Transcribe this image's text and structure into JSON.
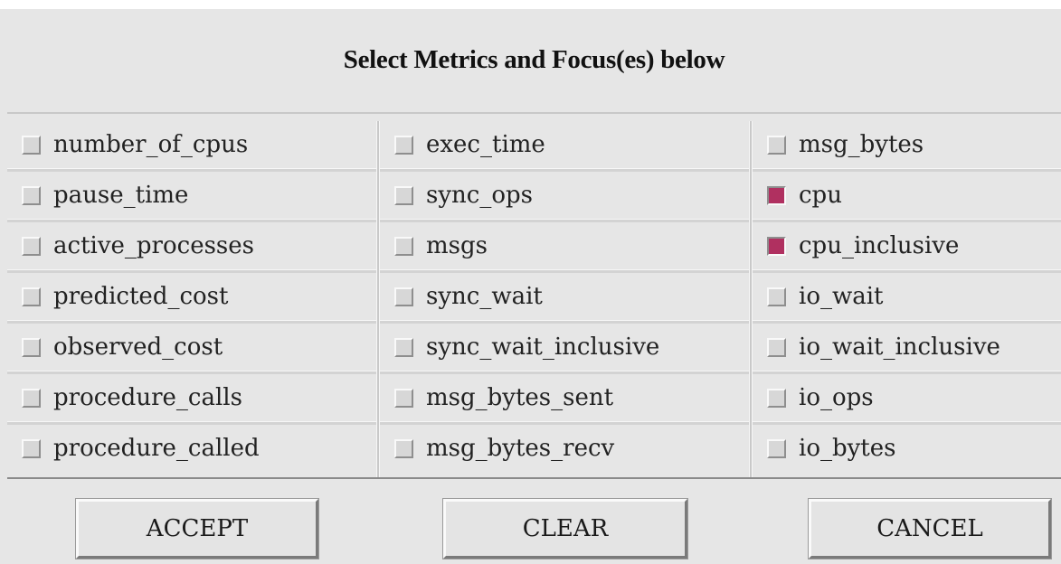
{
  "dialog": {
    "title": "Select Metrics and Focus(es) below"
  },
  "metrics": {
    "columns": [
      [
        {
          "label": "number_of_cpus",
          "checked": false
        },
        {
          "label": "pause_time",
          "checked": false
        },
        {
          "label": "active_processes",
          "checked": false
        },
        {
          "label": "predicted_cost",
          "checked": false
        },
        {
          "label": "observed_cost",
          "checked": false
        },
        {
          "label": "procedure_calls",
          "checked": false
        },
        {
          "label": "procedure_called",
          "checked": false
        }
      ],
      [
        {
          "label": "exec_time",
          "checked": false
        },
        {
          "label": "sync_ops",
          "checked": false
        },
        {
          "label": "msgs",
          "checked": false
        },
        {
          "label": "sync_wait",
          "checked": false
        },
        {
          "label": "sync_wait_inclusive",
          "checked": false
        },
        {
          "label": "msg_bytes_sent",
          "checked": false
        },
        {
          "label": "msg_bytes_recv",
          "checked": false
        }
      ],
      [
        {
          "label": "msg_bytes",
          "checked": false
        },
        {
          "label": "cpu",
          "checked": true
        },
        {
          "label": "cpu_inclusive",
          "checked": true
        },
        {
          "label": "io_wait",
          "checked": false
        },
        {
          "label": "io_wait_inclusive",
          "checked": false
        },
        {
          "label": "io_ops",
          "checked": false
        },
        {
          "label": "io_bytes",
          "checked": false
        }
      ]
    ],
    "checked_color": "#b03060"
  },
  "buttons": {
    "accept_label": "ACCEPT",
    "clear_label": "CLEAR",
    "cancel_label": "CANCEL"
  }
}
